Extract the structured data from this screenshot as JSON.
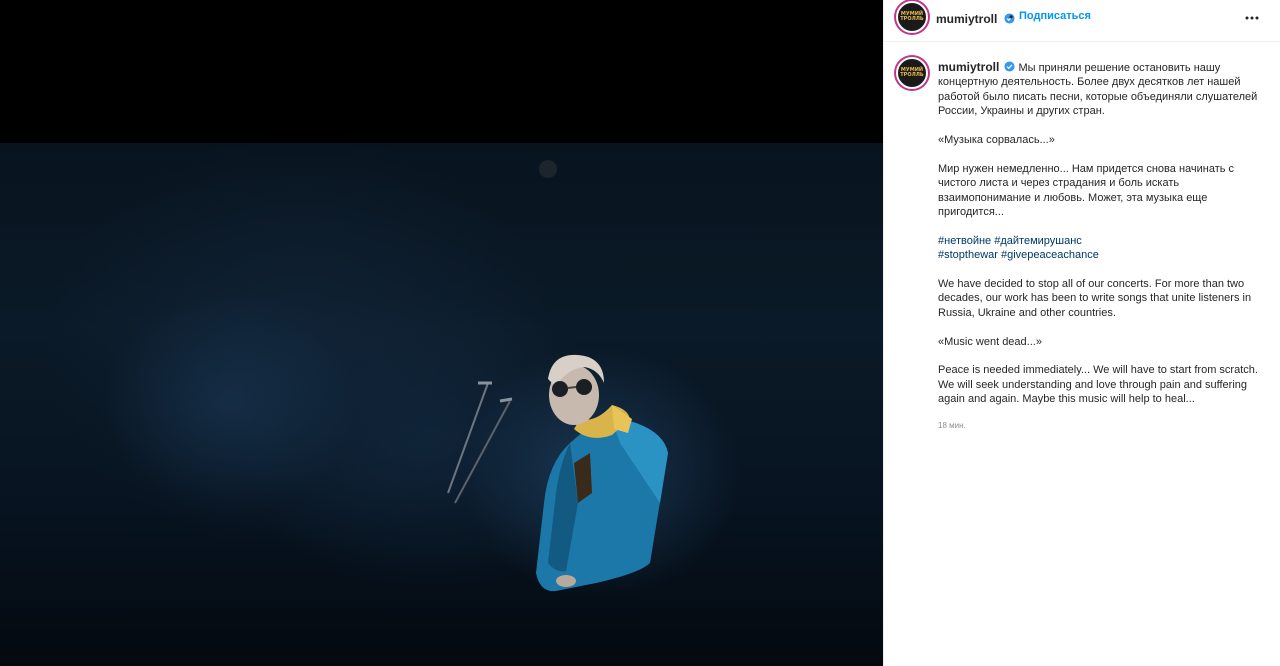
{
  "post": {
    "author": "mumiytroll",
    "follow_label": "Подписаться",
    "separator": "•",
    "avatar_text": "МУМИЙ ТРОЛЛЬ",
    "caption_ru_1": "Мы приняли решение остановить нашу концертную деятельность. Более двух десятков лет нашей работой было писать песни, которые объединяли слушателей России, Украины и других стран.",
    "caption_ru_2": "«Музыка сорвалась...»",
    "caption_ru_3": "Мир нужен немедленно... Нам придется снова начинать с чистого листа и через страдания и боль искать взаимопонимание и любовь. Может, эта музыка еще пригодится...",
    "hashtags": [
      "#нетвойне",
      "#дайтемирушанс",
      "#stopthewar",
      "#givepeaceachance"
    ],
    "caption_en_1": "We have decided to stop all of our concerts. For more than two decades, our work has been to write songs that unite listeners in Russia, Ukraine and other countries.",
    "caption_en_2": "«Music went dead...»",
    "caption_en_3": "Peace is needed immediately... We will have to start from scratch. We will seek understanding and love through pain and suffering again and again. Maybe this music will help to heal...",
    "timestamp": "18 мин."
  },
  "icons": {
    "verified": "verified-badge-icon",
    "more": "more-options-icon"
  },
  "colors": {
    "link": "#0095f6",
    "hashtag": "#00376b",
    "verified": "#3897f0",
    "muted": "#8e8e8e"
  }
}
